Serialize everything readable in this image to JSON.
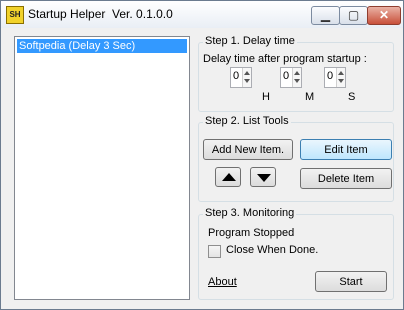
{
  "window": {
    "icon_text": "SH",
    "title": "Startup Helper  Ver. 0.1.0.0",
    "controls": {
      "minimize": "▁",
      "maximize": "▢",
      "close": "✕"
    }
  },
  "list": {
    "items": [
      {
        "label": "Softpedia (Delay 3 Sec)",
        "selected": true
      }
    ]
  },
  "step1": {
    "title": "Step 1. Delay time",
    "label": "Delay time after program startup :",
    "fields": [
      {
        "value": "0",
        "unit": "H"
      },
      {
        "value": "0",
        "unit": "M"
      },
      {
        "value": "0",
        "unit": "S"
      }
    ]
  },
  "step2": {
    "title": "Step 2. List Tools",
    "add_label": "Add New Item.",
    "edit_label": "Edit Item",
    "delete_label": "Delete Item"
  },
  "step3": {
    "title": "Step 3. Monitoring",
    "status": "Program Stopped",
    "close_when_done_label": "Close When Done.",
    "close_when_done_checked": false,
    "about_label": "About",
    "start_label": "Start"
  },
  "colors": {
    "selection": "#3399ff",
    "focus_button": "#bee6fd"
  }
}
